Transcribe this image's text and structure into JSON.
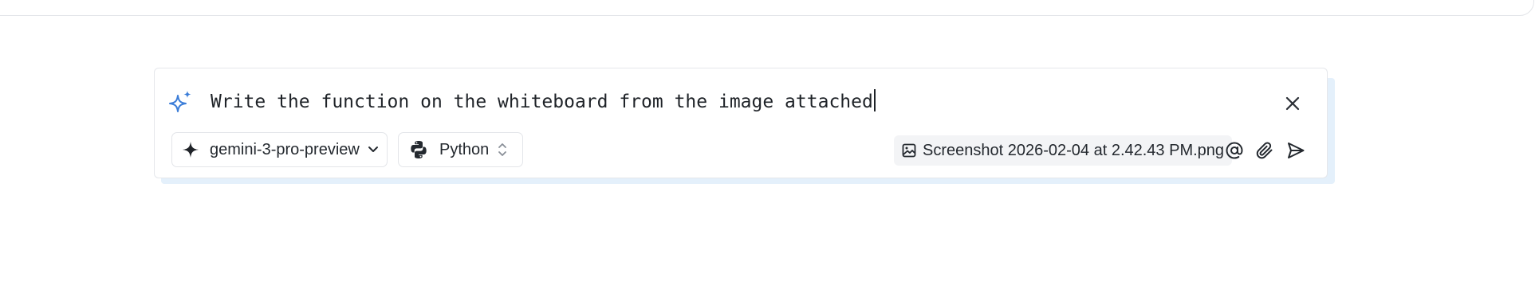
{
  "composer": {
    "prompt_value": "Write the function on the whiteboard from the image attached",
    "model_selector": {
      "label": "gemini-3-pro-preview",
      "icon": "sparkle-icon"
    },
    "language_selector": {
      "label": "Python",
      "icon": "python-icon"
    },
    "attachment": {
      "filename": "Screenshot 2026-02-04 at 2.42.43 PM.png",
      "icon": "image-icon"
    },
    "actions": [
      "mention-icon",
      "paperclip-icon",
      "send-icon"
    ],
    "accent_color": "#3b7dd8",
    "shadow_color": "#e4f0fb"
  }
}
